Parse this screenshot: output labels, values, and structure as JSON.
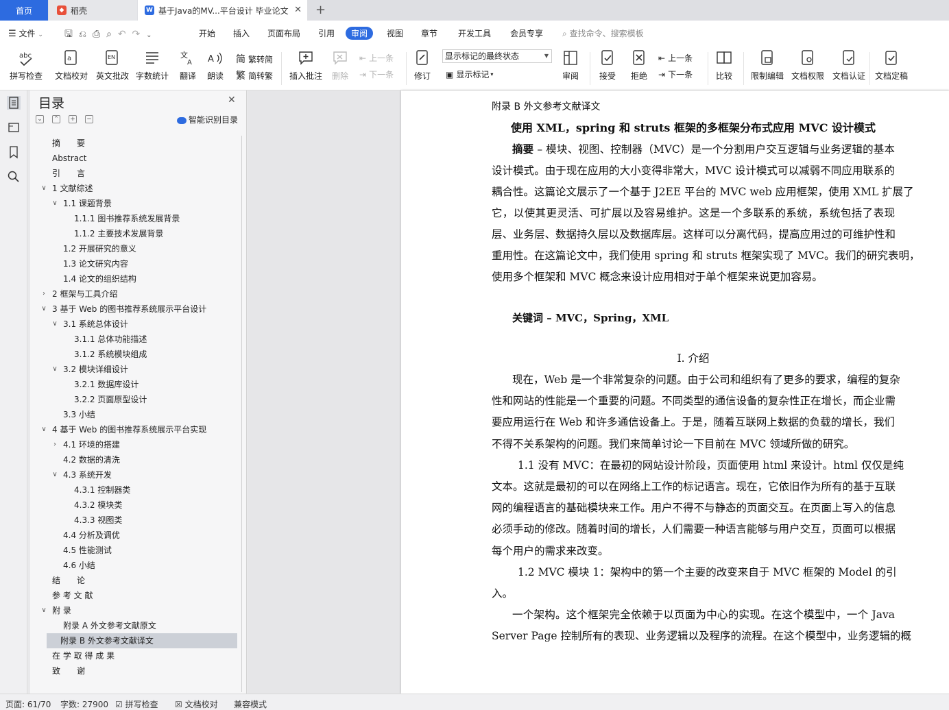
{
  "tabs": {
    "home": "首页",
    "daoke": "稻壳",
    "doc": "基于Java的MV...平台设计 毕业论文",
    "add": "+"
  },
  "menu": {
    "file": "文件",
    "items": [
      "开始",
      "插入",
      "页面布局",
      "引用",
      "审阅",
      "视图",
      "章节",
      "开发工具",
      "会员专享"
    ],
    "active": "审阅",
    "search_placeholder": "查找命令、搜索模板"
  },
  "ribbon": {
    "spell": "拼写检查",
    "doc_check": "文档校对",
    "en_review": "英文批改",
    "word_count": "字数统计",
    "translate": "翻译",
    "read": "朗读",
    "trad": "繁转简",
    "simp": "简转繁",
    "insert_comment": "插入批注",
    "delete": "删除",
    "prev": "上一条",
    "next": "下一条",
    "revise": "修订",
    "markup_select": "显示标记的最终状态",
    "show_markup": "显示标记",
    "review": "审阅",
    "accept": "接受",
    "reject": "拒绝",
    "prev2": "上一条",
    "next2": "下一条",
    "compare": "比较",
    "restrict": "限制编辑",
    "doc_perm": "文档权限",
    "doc_cert": "文档认证",
    "finalize": "文档定稿"
  },
  "toc": {
    "title": "目录",
    "smart": "智能识别目录",
    "items": [
      {
        "label": "摘　　要",
        "level": 0,
        "arrow": ""
      },
      {
        "label": "Abstract",
        "level": 0,
        "arrow": ""
      },
      {
        "label": "引　　言",
        "level": 0,
        "arrow": ""
      },
      {
        "label": "1  文献综述",
        "level": 0,
        "arrow": "v"
      },
      {
        "label": "1.1  课题背景",
        "level": 1,
        "arrow": "v"
      },
      {
        "label": "1.1.1  图书推荐系统发展背景",
        "level": 2,
        "arrow": ""
      },
      {
        "label": "1.1.2  主要技术发展背景",
        "level": 2,
        "arrow": ""
      },
      {
        "label": "1.2  开展研究的意义",
        "level": 1,
        "arrow": ""
      },
      {
        "label": "1.3  论文研究内容",
        "level": 1,
        "arrow": ""
      },
      {
        "label": "1.4  论文的组织结构",
        "level": 1,
        "arrow": ""
      },
      {
        "label": "2  框架与工具介绍",
        "level": 0,
        "arrow": ">"
      },
      {
        "label": "3  基于 Web 的图书推荐系统展示平台设计",
        "level": 0,
        "arrow": "v"
      },
      {
        "label": "3.1  系统总体设计",
        "level": 1,
        "arrow": "v"
      },
      {
        "label": "3.1.1  总体功能描述",
        "level": 2,
        "arrow": ""
      },
      {
        "label": "3.1.2  系统模块组成",
        "level": 2,
        "arrow": ""
      },
      {
        "label": "3.2  模块详细设计",
        "level": 1,
        "arrow": "v"
      },
      {
        "label": "3.2.1  数据库设计",
        "level": 2,
        "arrow": ""
      },
      {
        "label": "3.2.2  页面原型设计",
        "level": 2,
        "arrow": ""
      },
      {
        "label": "3.3  小结",
        "level": 1,
        "arrow": ""
      },
      {
        "label": "4  基于 Web 的图书推荐系统展示平台实现",
        "level": 0,
        "arrow": "v"
      },
      {
        "label": "4.1  环境的搭建",
        "level": 1,
        "arrow": ">"
      },
      {
        "label": "4.2  数据的清洗",
        "level": 1,
        "arrow": ""
      },
      {
        "label": "4.3  系统开发",
        "level": 1,
        "arrow": "v"
      },
      {
        "label": "4.3.1  控制器类",
        "level": 2,
        "arrow": ""
      },
      {
        "label": "4.3.2  模块类",
        "level": 2,
        "arrow": ""
      },
      {
        "label": "4.3.3  视图类",
        "level": 2,
        "arrow": ""
      },
      {
        "label": "4.4  分析及调优",
        "level": 1,
        "arrow": ""
      },
      {
        "label": "4.5  性能测试",
        "level": 1,
        "arrow": ""
      },
      {
        "label": "4.6  小结",
        "level": 1,
        "arrow": ""
      },
      {
        "label": "结　　论",
        "level": 0,
        "arrow": ""
      },
      {
        "label": "参 考 文 献",
        "level": 0,
        "arrow": ""
      },
      {
        "label": "附 录",
        "level": 0,
        "arrow": "v"
      },
      {
        "label": "附录 A  外文参考文献原文",
        "level": 1,
        "arrow": ""
      },
      {
        "label": "附录 B  外文参考文献译文",
        "level": 1,
        "arrow": "",
        "selected": true
      },
      {
        "label": "在 学 取 得 成 果",
        "level": 0,
        "arrow": ""
      },
      {
        "label": "致　　谢",
        "level": 0,
        "arrow": ""
      }
    ]
  },
  "document": {
    "appendix_heading": "附录 B  外文参考文献译文",
    "title": "使用 XML，spring 和 struts 框架的多框架分布式应用 MVC 设计模式",
    "abstract_label": "摘要",
    "abstract_lines": [
      " – 模块、视图、控制器（MVC）是一个分割用户交互逻辑与业务逻辑的基本",
      "设计模式。由于现在应用的大小变得非常大，MVC 设计模式可以减弱不同应用联系的",
      "耦合性。这篇论文展示了一个基于 J2EE 平台的 MVC web 应用框架，使用 XML 扩展了",
      "它，以使其更灵活、可扩展以及容易维护。这是一个多联系的系统，系统包括了表现",
      "层、业务层、数据持久层以及数据库层。这样可以分离代码，提高应用过的可维护性和",
      "重用性。在这篇论文中，我们使用 spring 和 struts 框架实现了 MVC。我们的研究表明，",
      "使用多个框架和 MVC 概念来设计应用相对于单个框架来说更加容易。"
    ],
    "keywords": "关键词 – MVC，Spring，XML",
    "section1": "I.  介绍",
    "intro_lines": [
      "现在，Web 是一个非常复杂的问题。由于公司和组织有了更多的要求，编程的复杂",
      "性和网站的性能是一个重要的问题。不同类型的通信设备的复杂性正在增长，而企业需",
      "要应用运行在 Web 和许多通信设备上。于是，随着互联网上数据的负载的增长，我们",
      "不得不关系架构的问题。我们来简单讨论一下目前在 MVC 领域所做的研究。"
    ],
    "p11_lines": [
      "1.1   没有 MVC：在最初的网站设计阶段，页面使用 html 来设计。html 仅仅是纯",
      "文本。这就是最初的可以在网络上工作的标记语言。现在，它依旧作为所有的基于互联",
      "网的编程语言的基础模块来工作。用户不得不与静态的页面交互。在页面上写入的信息",
      "必须手动的修改。随着时间的增长，人们需要一种语言能够与用户交互，页面可以根据",
      "每个用户的需求来改变。"
    ],
    "p12_lines": [
      "1.2   MVC 模块 1：架构中的第一个主要的改变来自于 MVC 框架的 Model 的引",
      "入。"
    ],
    "p13_lines": [
      "一个架构。这个框架完全依赖于以页面为中心的实现。在这个模型中，一个 Java",
      "Server Page 控制所有的表现、业务逻辑以及程序的流程。在这个模型中，业务逻辑的概"
    ]
  },
  "status": {
    "page": "页面: 61/70",
    "words": "字数: 27900",
    "spell": "拼写检查",
    "doc_check": "文档校对",
    "compat": "兼容模式"
  }
}
